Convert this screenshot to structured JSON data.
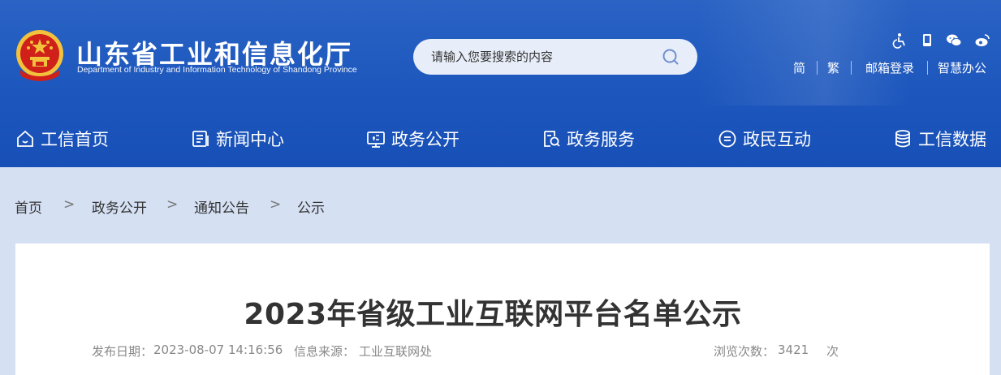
{
  "header": {
    "site_title": "山东省工业和信息化厅",
    "site_subtitle": "Department of Industry and Information Technology of Shandong Province",
    "search": {
      "placeholder": "请输入您要搜索的内容"
    },
    "top_icons": [
      "accessibility-icon",
      "mobile-icon",
      "wechat-icon",
      "weibo-icon"
    ],
    "top_links": [
      "简",
      "繁",
      "邮箱登录",
      "智慧办公"
    ]
  },
  "nav": {
    "items": [
      {
        "label": "工信首页",
        "icon": "home-icon"
      },
      {
        "label": "新闻中心",
        "icon": "news-icon"
      },
      {
        "label": "政务公开",
        "icon": "public-affairs-icon"
      },
      {
        "label": "政务服务",
        "icon": "service-icon"
      },
      {
        "label": "政民互动",
        "icon": "interaction-icon"
      },
      {
        "label": "工信数据",
        "icon": "database-icon"
      }
    ]
  },
  "breadcrumb": {
    "items": [
      "首页",
      "政务公开",
      "通知公告",
      "公示"
    ],
    "separator": ">"
  },
  "article": {
    "title": "2023年省级工业互联网平台名单公示",
    "publish_label": "发布日期：",
    "publish_date": "2023-08-07 14:16:56",
    "source_label": "信息来源：",
    "source": "工业互联网处",
    "views_label": "浏览次数：",
    "views": "3421",
    "views_unit": "次"
  },
  "colors": {
    "header_blue": "#1d57bd",
    "page_bg": "#d5e0f3",
    "emblem_red": "#d0201a",
    "emblem_gold": "#f2c23c"
  }
}
